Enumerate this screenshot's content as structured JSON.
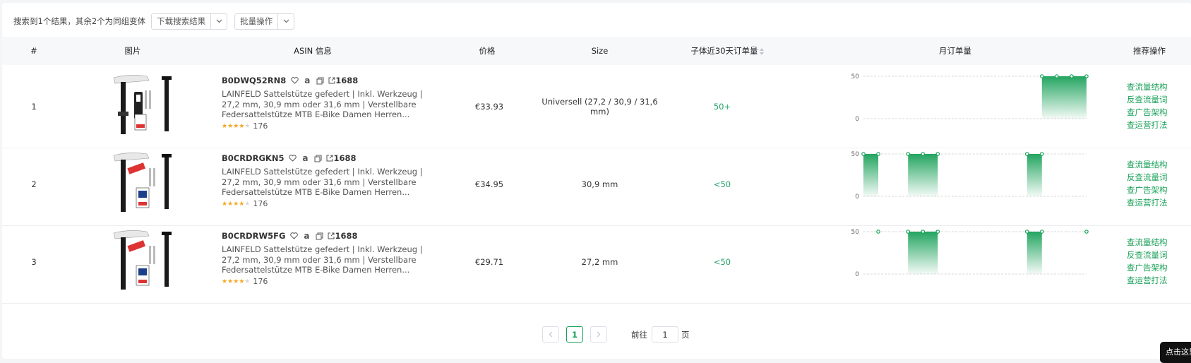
{
  "toolbar": {
    "summary": "搜索到1个结果，其余2个为同组变体",
    "download_label": "下载搜索结果",
    "batch_label": "批量操作"
  },
  "columns": {
    "index": "#",
    "image": "图片",
    "asin_info": "ASIN 信息",
    "price": "价格",
    "size": "Size",
    "child_orders_30d": "子体近30天订单量",
    "monthly_orders": "月订单量",
    "actions": "推荐操作"
  },
  "chart_axis": {
    "top_label": "50",
    "bottom_label": "0",
    "max": 50
  },
  "rows": [
    {
      "index": "1",
      "asin": "B0DWQ52RN8",
      "link_label": "1688",
      "title": "LAINFELD Sattelstütze gefedert | Inkl. Werkzeug | 27,2 mm, 30,9 mm oder 31,6 mm | Verstellbare Federsattelstütze MTB E-Bike Damen Herren...",
      "stars": 4,
      "rating_count": "176",
      "price": "€33.93",
      "size": "Universell (27,2 / 30,9 / 31,6 mm)",
      "orders_30d": "50+",
      "monthly": [
        null,
        null,
        null,
        null,
        null,
        null,
        null,
        null,
        null,
        null,
        null,
        null,
        50,
        50,
        50,
        50
      ]
    },
    {
      "index": "2",
      "asin": "B0CRDRGKN5",
      "link_label": "1688",
      "title": "LAINFELD Sattelstütze gefedert | Inkl. Werkzeug | 27,2 mm, 30,9 mm oder 31,6 mm | Verstellbare Federsattelstütze MTB E-Bike Damen Herren...",
      "stars": 4,
      "rating_count": "176",
      "price": "€34.95",
      "size": "30,9 mm",
      "orders_30d": "<50",
      "monthly": [
        50,
        50,
        null,
        50,
        50,
        50,
        null,
        null,
        null,
        null,
        null,
        50,
        50,
        null,
        null,
        null
      ]
    },
    {
      "index": "3",
      "asin": "B0CRDRW5FG",
      "link_label": "1688",
      "title": "LAINFELD Sattelstütze gefedert | Inkl. Werkzeug | 27,2 mm, 30,9 mm oder 31,6 mm | Verstellbare Federsattelstütze MTB E-Bike Damen Herren...",
      "stars": 4,
      "rating_count": "176",
      "price": "€29.71",
      "size": "27,2 mm",
      "orders_30d": "<50",
      "monthly": [
        null,
        50,
        null,
        50,
        50,
        50,
        null,
        null,
        null,
        null,
        null,
        50,
        50,
        null,
        null,
        50
      ]
    }
  ],
  "action_links": [
    "查流量结构",
    "反查流量词",
    "查广告架构",
    "查运营打法"
  ],
  "pagination": {
    "current": "1",
    "goto_label": "前往",
    "goto_value": "1",
    "page_suffix": "页"
  },
  "floating_tag": "点击这里",
  "colors": {
    "accent": "#18a058",
    "green_text": "#21a366",
    "star": "#f5a623"
  }
}
